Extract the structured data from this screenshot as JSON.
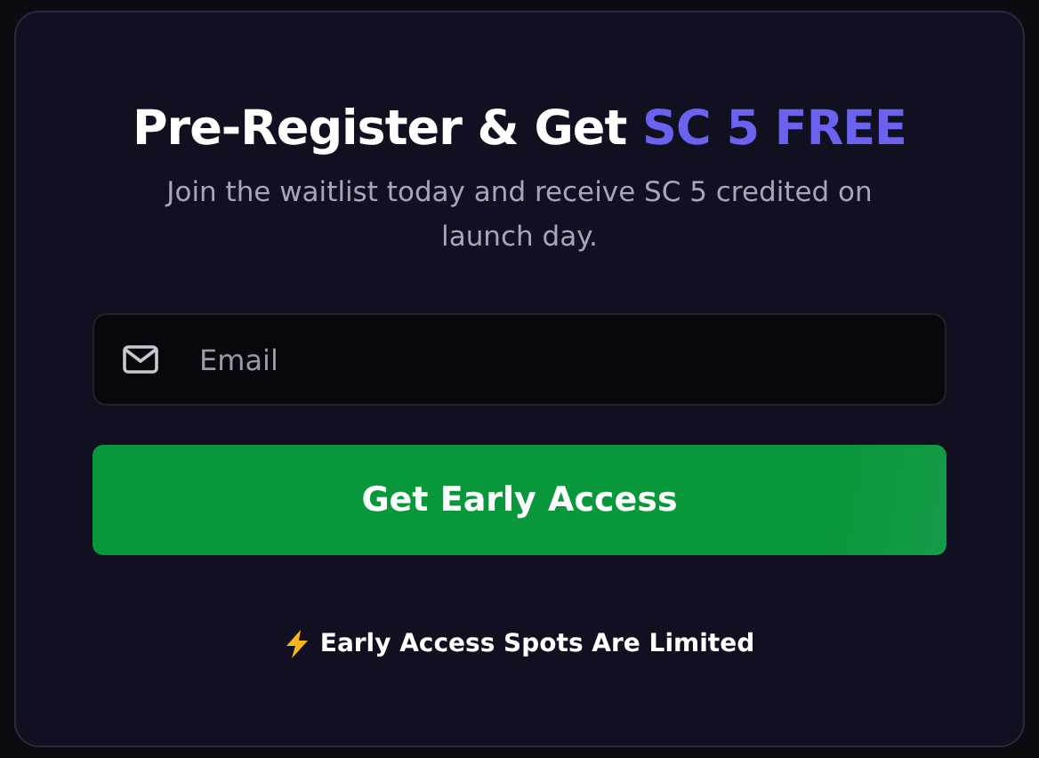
{
  "heading": {
    "text": "Pre-Register & Get",
    "highlight": "SC 5 FREE"
  },
  "subtitle": "Join the waitlist today and receive SC 5 credited on launch day.",
  "email_field": {
    "placeholder": "Email"
  },
  "submit_button": "Get Early Access",
  "notice": "Early Access Spots Are Limited"
}
